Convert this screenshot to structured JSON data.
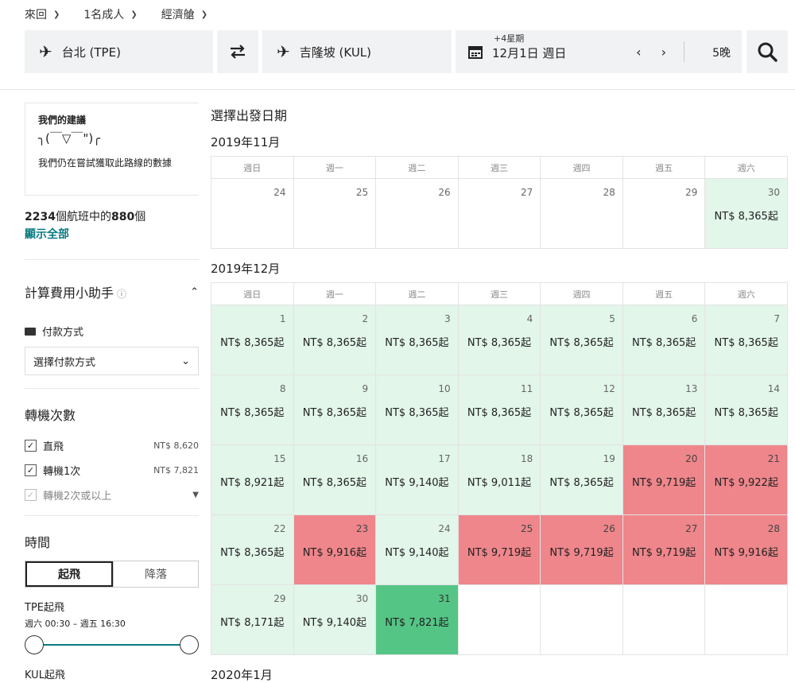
{
  "options": {
    "trip": "來回",
    "passengers": "1名成人",
    "cabin": "經濟艙"
  },
  "search": {
    "origin": "台北 (TPE)",
    "destination": "吉隆坡 (KUL)",
    "date_plus": "+4星期",
    "date_main": "12月1日 週日",
    "nav": "‹ ›",
    "nights": "5晚"
  },
  "sidebar": {
    "reco_title": "我們的建議",
    "reco_face": "╮(￣▽￣\")╭",
    "reco_text": "我們仍在嘗試獲取此路線的數據",
    "count_total": "2234",
    "count_mid": "個航班中的",
    "count_shown": "880",
    "count_suffix": "個",
    "show_all": "顯示全部",
    "calc_title": "計算費用小助手",
    "pay_label": "付款方式",
    "pay_select": "選擇付款方式",
    "stops_title": "轉機次數",
    "stops": [
      {
        "label": "直飛",
        "price": "NT$ 8,620",
        "checked": true
      },
      {
        "label": "轉機1次",
        "price": "NT$ 7,821",
        "checked": true
      },
      {
        "label": "轉機2次或以上",
        "price": "",
        "checked": false
      }
    ],
    "time_title": "時間",
    "tab_depart": "起飛",
    "tab_arrive": "降落",
    "tpe_label": "TPE起飛",
    "tpe_range": "週六 00:30 – 週五 16:30",
    "kul_label": "KUL起飛"
  },
  "calendar": {
    "heading": "選擇出發日期",
    "weekdays": [
      "週日",
      "週一",
      "週二",
      "週三",
      "週四",
      "週五",
      "週六"
    ],
    "months": [
      {
        "title": "2019年11月",
        "days": [
          {
            "n": "24",
            "p": "",
            "s": "plain"
          },
          {
            "n": "25",
            "p": "",
            "s": "plain"
          },
          {
            "n": "26",
            "p": "",
            "s": "plain"
          },
          {
            "n": "27",
            "p": "",
            "s": "plain"
          },
          {
            "n": "28",
            "p": "",
            "s": "plain"
          },
          {
            "n": "29",
            "p": "",
            "s": "plain"
          },
          {
            "n": "30",
            "p": "NT$ 8,365起",
            "s": "green"
          }
        ]
      },
      {
        "title": "2019年12月",
        "days": [
          {
            "n": "1",
            "p": "NT$ 8,365起",
            "s": "green"
          },
          {
            "n": "2",
            "p": "NT$ 8,365起",
            "s": "green"
          },
          {
            "n": "3",
            "p": "NT$ 8,365起",
            "s": "green"
          },
          {
            "n": "4",
            "p": "NT$ 8,365起",
            "s": "green"
          },
          {
            "n": "5",
            "p": "NT$ 8,365起",
            "s": "green"
          },
          {
            "n": "6",
            "p": "NT$ 8,365起",
            "s": "green"
          },
          {
            "n": "7",
            "p": "NT$ 8,365起",
            "s": "green"
          },
          {
            "n": "8",
            "p": "NT$ 8,365起",
            "s": "green"
          },
          {
            "n": "9",
            "p": "NT$ 8,365起",
            "s": "green"
          },
          {
            "n": "10",
            "p": "NT$ 8,365起",
            "s": "green"
          },
          {
            "n": "11",
            "p": "NT$ 8,365起",
            "s": "green"
          },
          {
            "n": "12",
            "p": "NT$ 8,365起",
            "s": "green"
          },
          {
            "n": "13",
            "p": "NT$ 8,365起",
            "s": "green"
          },
          {
            "n": "14",
            "p": "NT$ 8,365起",
            "s": "green"
          },
          {
            "n": "15",
            "p": "NT$ 8,921起",
            "s": "green"
          },
          {
            "n": "16",
            "p": "NT$ 8,365起",
            "s": "green"
          },
          {
            "n": "17",
            "p": "NT$ 9,140起",
            "s": "green"
          },
          {
            "n": "18",
            "p": "NT$ 9,011起",
            "s": "green"
          },
          {
            "n": "19",
            "p": "NT$ 8,365起",
            "s": "green"
          },
          {
            "n": "20",
            "p": "NT$ 9,719起",
            "s": "red"
          },
          {
            "n": "21",
            "p": "NT$ 9,922起",
            "s": "red"
          },
          {
            "n": "22",
            "p": "NT$ 8,365起",
            "s": "green"
          },
          {
            "n": "23",
            "p": "NT$ 9,916起",
            "s": "red"
          },
          {
            "n": "24",
            "p": "NT$ 9,140起",
            "s": "green"
          },
          {
            "n": "25",
            "p": "NT$ 9,719起",
            "s": "red"
          },
          {
            "n": "26",
            "p": "NT$ 9,719起",
            "s": "red"
          },
          {
            "n": "27",
            "p": "NT$ 9,719起",
            "s": "red"
          },
          {
            "n": "28",
            "p": "NT$ 9,916起",
            "s": "red"
          },
          {
            "n": "29",
            "p": "NT$ 8,171起",
            "s": "green"
          },
          {
            "n": "30",
            "p": "NT$ 9,140起",
            "s": "green"
          },
          {
            "n": "31",
            "p": "NT$ 7,821起",
            "s": "best"
          },
          {
            "n": "",
            "p": "",
            "s": "empty"
          },
          {
            "n": "",
            "p": "",
            "s": "empty"
          },
          {
            "n": "",
            "p": "",
            "s": "empty"
          },
          {
            "n": "",
            "p": "",
            "s": "empty"
          }
        ]
      }
    ],
    "next_month": "2020年1月"
  }
}
